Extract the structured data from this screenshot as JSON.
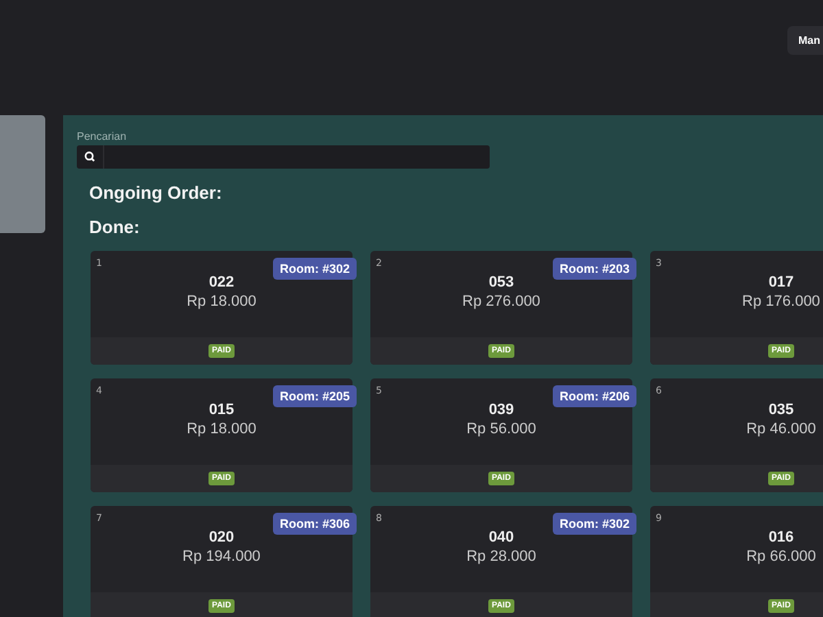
{
  "header": {
    "button": "Man"
  },
  "search": {
    "label": "Pencarian"
  },
  "sections": [
    {
      "title": "Ongoing Order:"
    },
    {
      "title": "Done:"
    }
  ],
  "orders": [
    {
      "index": "1",
      "code": "022",
      "price": "Rp 18.000",
      "room": "Room: #302",
      "status": {
        "kind": "paid",
        "label": "PAID"
      }
    },
    {
      "index": "2",
      "code": "053",
      "price": "Rp 276.000",
      "room": "Room: #203",
      "status": {
        "kind": "paid",
        "label": "PAID"
      }
    },
    {
      "index": "3",
      "code": "017",
      "price": "Rp 176.000",
      "status": {
        "kind": "paid",
        "label": "PAID"
      }
    },
    {
      "index": "4",
      "code": "015",
      "price": "Rp 18.000",
      "room": "Room: #205",
      "status": {
        "kind": "paid",
        "label": "PAID"
      }
    },
    {
      "index": "5",
      "code": "039",
      "price": "Rp 56.000",
      "room": "Room: #206",
      "status": {
        "kind": "paid",
        "label": "PAID"
      }
    },
    {
      "index": "6",
      "code": "035",
      "price": "Rp 46.000",
      "status": {
        "kind": "paid",
        "label": "PAID"
      }
    },
    {
      "index": "7",
      "code": "020",
      "price": "Rp 194.000",
      "room": "Room: #306",
      "status": {
        "kind": "paid",
        "label": "PAID"
      }
    },
    {
      "index": "8",
      "code": "040",
      "price": "Rp 28.000",
      "room": "Room: #302",
      "status": {
        "kind": "paid",
        "label": "PAID"
      }
    },
    {
      "index": "9",
      "code": "016",
      "price": "Rp 66.000",
      "status": {
        "kind": "paid",
        "label": "PAID"
      }
    }
  ]
}
